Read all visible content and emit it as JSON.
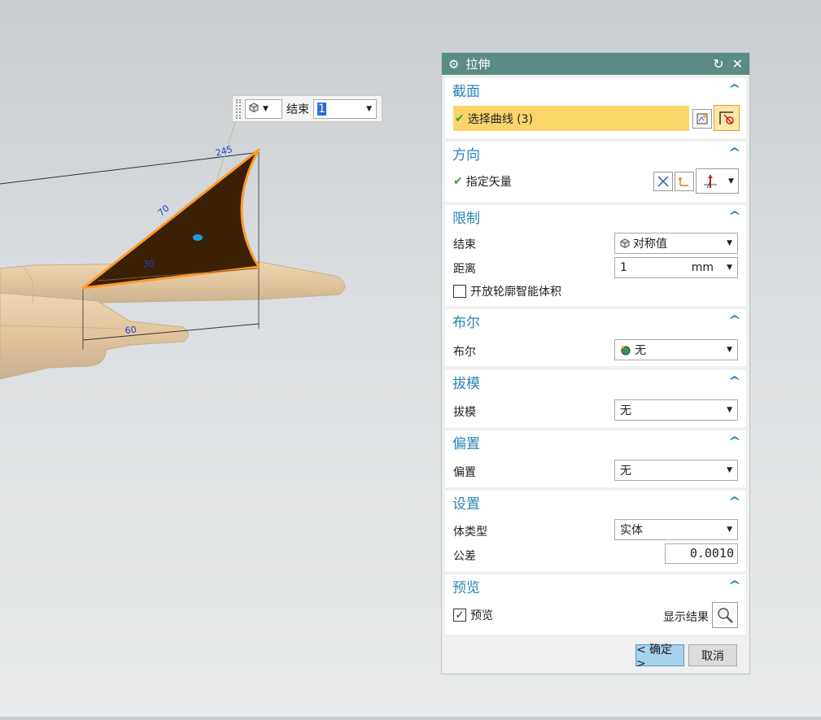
{
  "viewport": {
    "dimensions": {
      "d245": "245",
      "d70": "70",
      "d30": "30",
      "d60": "60"
    }
  },
  "mini_toolbar": {
    "end_label": "结束",
    "end_value": "1"
  },
  "dialog": {
    "title": "拉伸",
    "section": {
      "header": "截面",
      "select_curve_label": "选择曲线 (3)"
    },
    "direction": {
      "header": "方向",
      "specify_vector_label": "指定矢量"
    },
    "limits": {
      "header": "限制",
      "end_label": "结束",
      "end_value": "对称值",
      "distance_label": "距离",
      "distance_value": "1",
      "distance_unit": "mm",
      "open_profile_label": "开放轮廓智能体积"
    },
    "boolean": {
      "header": "布尔",
      "label": "布尔",
      "value": "无"
    },
    "draft": {
      "header": "拔模",
      "label": "拔模",
      "value": "无"
    },
    "offset": {
      "header": "偏置",
      "label": "偏置",
      "value": "无"
    },
    "settings": {
      "header": "设置",
      "body_type_label": "体类型",
      "body_type_value": "实体",
      "tolerance_label": "公差",
      "tolerance_value": "0.0010"
    },
    "preview": {
      "header": "预览",
      "preview_label": "预览",
      "show_result_label": "显示结果"
    },
    "ok_label": "< 确定 >",
    "cancel_label": "取消"
  },
  "colors": {
    "title_bar": "#5a8c85",
    "section_header": "#2a86b4",
    "selection_highlight": "#fbd46a",
    "curve_highlight": "#ff9a2e",
    "fin_fill": "#3a2004",
    "ok_button": "#a8d1ec"
  }
}
